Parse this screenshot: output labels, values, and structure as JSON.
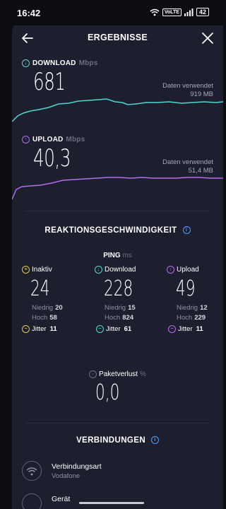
{
  "statusbar": {
    "time": "16:42",
    "volte": "VoLTE",
    "battery": "42"
  },
  "header": {
    "title": "ERGEBNISSE"
  },
  "download": {
    "label": "DOWNLOAD",
    "unit": "Mbps",
    "value": "681",
    "data_label": "Daten verwendet",
    "data_value": "919 MB",
    "color": "#4fd8d0"
  },
  "upload": {
    "label": "UPLOAD",
    "unit": "Mbps",
    "value": "40,3",
    "data_label": "Daten verwendet",
    "data_value": "51,4 MB",
    "color": "#b56cf0"
  },
  "reaktion": {
    "title": "REAKTIONSGESCHWINDIGKEIT",
    "ping_label": "PING",
    "ping_unit": "ms",
    "columns": [
      {
        "label": "Inaktiv",
        "value": "24",
        "low_label": "Niedrig",
        "low": "20",
        "high_label": "Hoch",
        "high": "58",
        "jitter_label": "Jitter",
        "jitter": "11",
        "icon": "idle-icon",
        "color": "#e6c84c"
      },
      {
        "label": "Download",
        "value": "228",
        "low_label": "Niedrig",
        "low": "15",
        "high_label": "Hoch",
        "high": "824",
        "jitter_label": "Jitter",
        "jitter": "61",
        "icon": "arrow-down-icon",
        "color": "#4fd8d0"
      },
      {
        "label": "Upload",
        "value": "49",
        "low_label": "Niedrig",
        "low": "12",
        "high_label": "Hoch",
        "high": "229",
        "jitter_label": "Jitter",
        "jitter": "11",
        "icon": "arrow-up-icon",
        "color": "#b56cf0"
      }
    ],
    "loss_label": "Paketverlust",
    "loss_unit": "%",
    "loss_value": "0,0"
  },
  "verbindungen": {
    "title": "VERBINDUNGEN",
    "items": [
      {
        "title": "Verbindungsart",
        "sub": "Vodafone",
        "icon": "wifi-icon"
      },
      {
        "title": "Gerät",
        "sub": "",
        "icon": "device-icon"
      }
    ]
  }
}
